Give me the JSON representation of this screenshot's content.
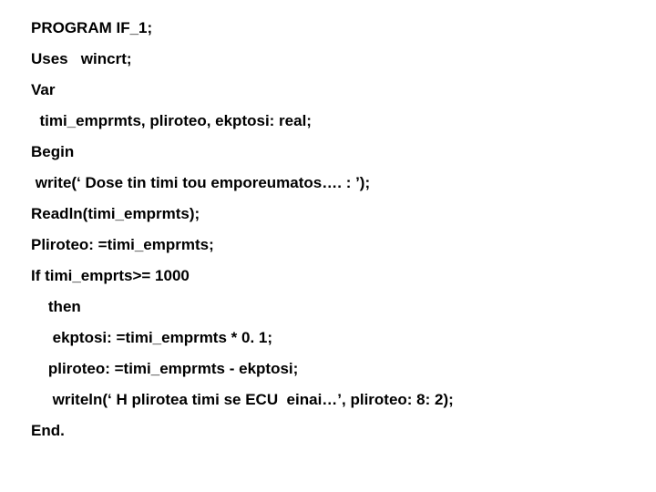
{
  "lines": [
    "PROGRAM IF_1;",
    "Uses   wincrt;",
    "Var",
    "  timi_emprmts, pliroteo, ekptosi: real;",
    "Begin",
    " write(‘ Dose tin timi tou emporeumatos…. : ’);",
    "Readln(timi_emprmts);",
    "Pliroteo: =timi_emprmts;",
    "If timi_emprts>= 1000",
    "    then",
    "     ekptosi: =timi_emprmts * 0. 1;",
    "    pliroteo: =timi_emprmts - ekptosi;",
    "     writeln(‘ H plirotea timi se ECU  einai…’, pliroteo: 8: 2);",
    "End."
  ]
}
